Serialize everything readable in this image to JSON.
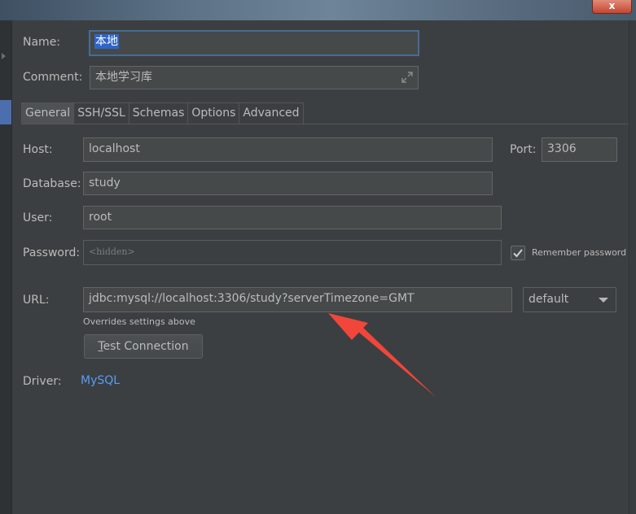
{
  "window": {
    "close_glyph": "x"
  },
  "form": {
    "name": {
      "label": "Name:",
      "value": "本地"
    },
    "comment": {
      "label": "Comment:",
      "value": "本地学习库"
    },
    "tabs": [
      {
        "label": "General",
        "active": true
      },
      {
        "label": "SSH/SSL",
        "active": false
      },
      {
        "label": "Schemas",
        "active": false
      },
      {
        "label": "Options",
        "active": false
      },
      {
        "label": "Advanced",
        "active": false
      }
    ],
    "host": {
      "label": "Host:",
      "value": "localhost"
    },
    "port": {
      "label": "Port:",
      "value": "3306"
    },
    "database": {
      "label": "Database:",
      "value": "study"
    },
    "user": {
      "label": "User:",
      "value": "root"
    },
    "password": {
      "label": "Password:",
      "placeholder": "<hidden>"
    },
    "remember_password": {
      "label": "Remember password",
      "checked": true
    },
    "url": {
      "label": "URL:",
      "value": "jdbc:mysql://localhost:3306/study?serverTimezone=GMT",
      "hint": "Overrides settings above"
    },
    "url_mode": {
      "selected": "default"
    },
    "test_connection": {
      "label": "Test Connection"
    },
    "driver": {
      "label": "Driver:",
      "value": "MySQL"
    }
  },
  "colors": {
    "background": "#3c3f41",
    "field_bg": "#45494a",
    "selection": "#2f65ca",
    "focus_border": "#466d94",
    "link": "#589df6",
    "annotation_arrow": "#f2463a"
  },
  "icons": {
    "expand": "expand-arrows-icon",
    "checkbox": "checkmark-icon",
    "combo": "chevron-down-icon",
    "close": "close-icon"
  }
}
